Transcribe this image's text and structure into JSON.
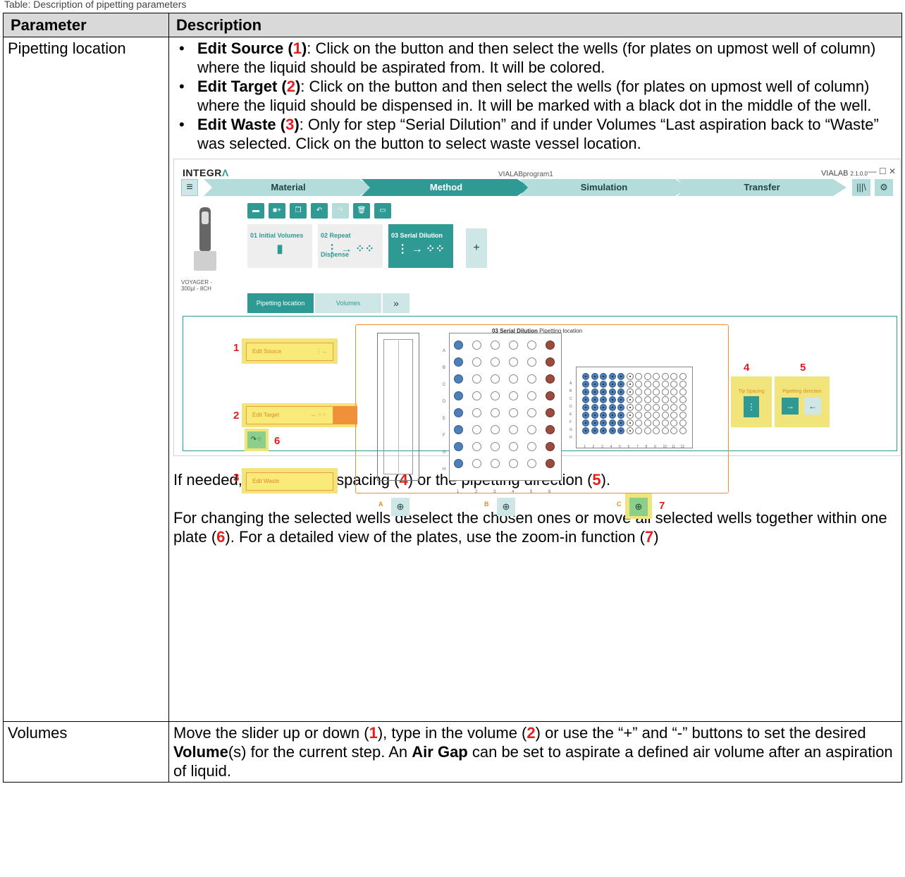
{
  "caption": "Table: Description of pipetting parameters",
  "table": {
    "header": {
      "param": "Parameter",
      "desc": "Description"
    },
    "rows": [
      {
        "param": "Pipetting location"
      },
      {
        "param": "Volumes"
      }
    ]
  },
  "pipetting": {
    "bullets": [
      {
        "title": "Edit Source (",
        "num": "1",
        "close": ")",
        "text": ": Click on the button and then select the wells (for plates on upmost well of column) where the liquid should be aspirated from. It will be colored."
      },
      {
        "title": "Edit Target (",
        "num": "2",
        "close": ")",
        "text": ": Click on the button and then select the wells (for plates on upmost well of column) where the liquid should be dispensed in. It will be marked with a black dot in the middle of the well."
      },
      {
        "title": "Edit Waste (",
        "num": "3",
        "close": ")",
        "text": ": Only for step “Serial Dilution” and if under Volumes “Last aspiration back to “Waste” was selected. Click on the button to select waste vessel location."
      }
    ],
    "para1": {
      "a": "If needed, adapt the tip spacing (",
      "n1": "4",
      "b": ") or the pipetting direction (",
      "n2": "5",
      "c": ")."
    },
    "para2": {
      "a": "For changing the selected wells deselect the chosen ones or move all selected wells together within one plate (",
      "n1": "6",
      "b": "). For a detailed view of the plates, use the zoom-in function (",
      "n2": "7",
      "c": ")"
    }
  },
  "volumes": {
    "a": "Move the slider up or down (",
    "n1": "1",
    "b": "), type in the volume (",
    "n2": "2",
    "c": ") or use the “+” and “-” buttons to set the desired ",
    "bold1": "Volume",
    "d": "(s) for the current step. An ",
    "bold2": "Air Gap",
    "e": " can be set to aspirate a defined air volume after an aspiration of liquid."
  },
  "screenshot": {
    "logo": "INTEGR",
    "logo_accent": "Λ",
    "program": "VIALABprogram1",
    "version_name": "VIALAB",
    "version": "2.1.0.0",
    "window_controls": "— ☐ ✕",
    "steps": [
      "Material",
      "Method",
      "Simulation",
      "Transfer"
    ],
    "active_step": "Method",
    "device_label": "VOYAGER - 300µl - 8CH",
    "cards": [
      "01 Initial Volumes",
      "02 Repeat Dispense",
      "03 Serial Dilution"
    ],
    "tabs": [
      "Pipetting location",
      "Volumes",
      "»"
    ],
    "panel_title_bold": "03 Serial Dilution",
    "panel_title": "Pipetting location",
    "buttons": {
      "source": "Edit Source",
      "target": "Edit Target",
      "waste": "Edit Waste",
      "tip_spacing": "Tip Spacing",
      "direction": "Pipetting direction"
    },
    "callouts": [
      "1",
      "2",
      "3",
      "4",
      "5",
      "6",
      "7"
    ],
    "plate_labels": [
      "A",
      "B",
      "C"
    ],
    "rows": [
      "A",
      "B",
      "C",
      "D",
      "E",
      "F",
      "G",
      "H"
    ],
    "cols6": [
      "1",
      "2",
      "3",
      "4",
      "5",
      "6"
    ],
    "cols12": [
      "1",
      "2",
      "3",
      "4",
      "5",
      "6",
      "7",
      "8",
      "9",
      "10",
      "11",
      "12"
    ],
    "colors": {
      "teal": "#2f9a93",
      "light_teal": "#b4dcda",
      "highlight": "#f1e47a",
      "orange": "#f0913a",
      "blue_well": "#4f7fb8",
      "brown_well": "#9a4b3e",
      "red_num": "#e21c1c"
    }
  }
}
